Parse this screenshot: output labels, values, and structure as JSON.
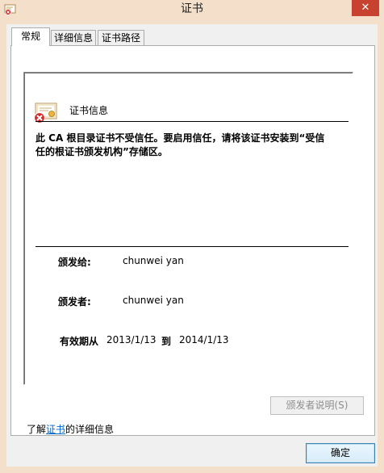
{
  "window": {
    "title": "证书",
    "close_symbol": "✕"
  },
  "tabs": [
    {
      "label": "常规",
      "active": true
    },
    {
      "label": "详细信息",
      "active": false
    },
    {
      "label": "证书路径",
      "active": false
    }
  ],
  "general": {
    "section_title": "证书信息",
    "warning_line1": "此 CA 根目录证书不受信任。要启用信任，请将该证书安装到“受信",
    "warning_line2": "任的根证书颁发机构”存储区。",
    "issued_to_label": "颁发给:",
    "issued_to_value": "chunwei yan",
    "issued_by_label": "颁发者:",
    "issued_by_value": "chunwei yan",
    "validity_label": "有效期从",
    "valid_from": "2013/1/13",
    "validity_to_label": "到",
    "valid_to": "2014/1/13",
    "issuer_statement_button": "颁发者说明(S)",
    "learn_prefix": "了解",
    "learn_link": "证书",
    "learn_suffix": "的详细信息"
  },
  "footer": {
    "ok_button": "确定"
  },
  "colors": {
    "frame": "#f3dfca",
    "close": "#c7432f",
    "link": "#0066cc",
    "error_badge": "#d42a2a"
  }
}
